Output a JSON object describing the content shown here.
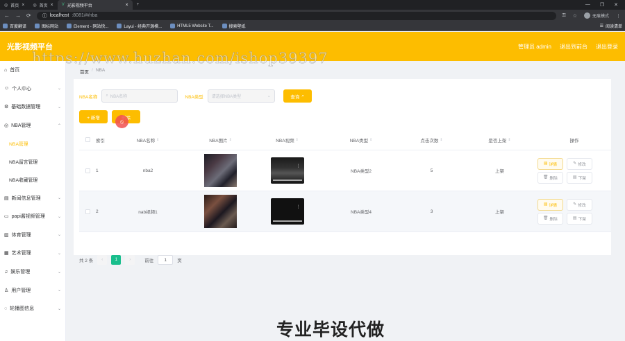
{
  "browser": {
    "tabs": [
      {
        "label": "首页"
      },
      {
        "label": "首页"
      },
      {
        "label": "光影视频平台",
        "active": true
      }
    ],
    "url_host": "localhost",
    "url_rest": ":8081/#/nba",
    "profile_label": "无痕模式",
    "bookmarks": [
      "百度翻译",
      "图标网站",
      "Element - 网站快...",
      "Layui - 经典开源模...",
      "HTML5 Website T...",
      "搜索壁纸"
    ],
    "bookmarks_right": "阅读清单"
  },
  "app": {
    "logo": "光影视频平台",
    "header_links": [
      "管理员 admin",
      "退出到前台",
      "退出登录"
    ],
    "watermark": "https://www.huzhan.com/ishop39397"
  },
  "sidebar": {
    "items": [
      {
        "label": "首页",
        "icon": "home-icon",
        "chevron": false
      },
      {
        "label": "个人中心",
        "icon": "user-icon",
        "chevron": true
      },
      {
        "label": "基础数据管理",
        "icon": "gear-icon",
        "chevron": true
      },
      {
        "label": "NBA管理",
        "icon": "basketball-icon",
        "chevron": true,
        "open": true
      }
    ],
    "subitems": [
      {
        "label": "NBA管理",
        "active": true
      },
      {
        "label": "NBA留言管理"
      },
      {
        "label": "NBA收藏管理"
      }
    ],
    "items_after": [
      {
        "label": "新闻信息管理",
        "icon": "news-icon"
      },
      {
        "label": "papi酱视频管理",
        "icon": "video-icon"
      },
      {
        "label": "体育管理",
        "icon": "sport-icon"
      },
      {
        "label": "艺术管理",
        "icon": "art-icon"
      },
      {
        "label": "娱乐管理",
        "icon": "music-icon"
      },
      {
        "label": "用户管理",
        "icon": "users-icon"
      },
      {
        "label": "轮播图信息",
        "icon": "image-icon"
      }
    ]
  },
  "breadcrumb": {
    "home": "首页",
    "sep": "/",
    "current": "NBA"
  },
  "filters": {
    "name_label": "NBA名称",
    "name_placeholder": "NBA名称",
    "type_label": "NBA类型",
    "type_placeholder": "请选择NBA类型",
    "search_label": "查询"
  },
  "actions": {
    "add_label": "+ 新增",
    "delete_label": "删除"
  },
  "table": {
    "headers": [
      "索引",
      "NBA名称",
      "NBA图片",
      "NBA视频",
      "NBA类型",
      "点击次数",
      "是否上架",
      "操作"
    ],
    "rows": [
      {
        "index": "1",
        "name": "nba2",
        "type": "NBA类型2",
        "clicks": "5",
        "status": "上架"
      },
      {
        "index": "2",
        "name": "nab视频1",
        "type": "NBA类型4",
        "clicks": "3",
        "status": "上架"
      }
    ],
    "row_buttons": [
      "详情",
      "修改",
      "删除",
      "下架"
    ]
  },
  "pagination": {
    "total": "共 2 条",
    "current": "1",
    "goto": "前往",
    "goto_value": "1",
    "page_suffix": "页"
  },
  "footer_overlay": "专业毕设代做",
  "colors": {
    "brand": "#fdbd00",
    "page_current": "#19be8c"
  }
}
